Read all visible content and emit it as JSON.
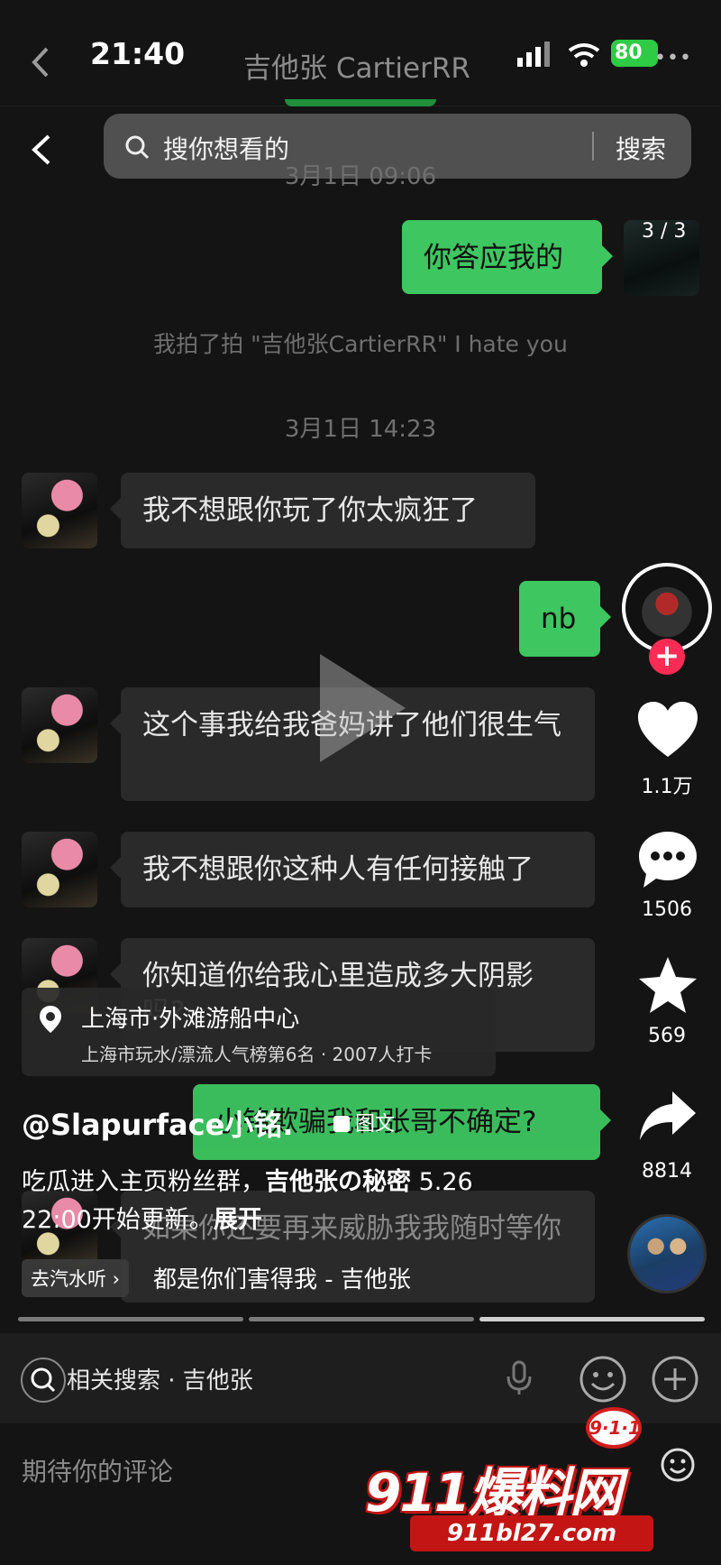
{
  "status_bar": {
    "time": "21:40",
    "battery": "80"
  },
  "chat": {
    "title": "吉他张 CartierRR",
    "messages_1": {
      "timestamp": "3月1日 09:06",
      "out_text": "你答应我的"
    },
    "system_msg": "我拍了拍 \"吉他张CartierRR\" I hate you",
    "messages_2": {
      "timestamp": "3月1日 14:23",
      "m1": "我不想跟你玩了你太疯狂了",
      "m2": "nb",
      "m3": "这个事我给我爸妈讲了他们很生气",
      "m4": "我不想跟你这种人有任何接触了",
      "m5": "你知道你给我心里造成多大阴影吗?",
      "m6": "小铭欺骗我和张哥不确定?",
      "m7": "如果你还要再来威胁我我随时等你"
    }
  },
  "search": {
    "placeholder": "搜你想看的",
    "button": "搜索"
  },
  "video": {
    "page_counter": "3 / 3",
    "likes": "1.1万",
    "comments": "1506",
    "favorites": "569",
    "shares": "8814",
    "follow": "+",
    "location": {
      "title": "上海市·外滩游船中心",
      "subtitle": "上海市玩水/漂流人气榜第6名 · 2007人打卡"
    },
    "author": "@Slapurface小铭.",
    "tag": "图文",
    "caption_prefix": "吃瓜进入主页粉丝群，",
    "caption_bold": "吉他张の秘密",
    "caption_suffix": " 5.26 22:00开始更新。",
    "caption_expand": "展开",
    "music_tag": "去汽水听 ›",
    "music_title": "都是你们害得我 - 吉他张"
  },
  "related": {
    "label": "相关搜索 · 吉他张"
  },
  "comment": {
    "placeholder": "期待你的评论"
  },
  "watermark": {
    "badge": "9·1·1",
    "brand": "911爆料网",
    "url": "911bl27.com"
  },
  "colors": {
    "bubble_out": "#3ec660",
    "bubble_in": "#2a2a2a",
    "follow": "#fe2c55",
    "brand_red": "#c41515"
  },
  "icons": [
    "back-icon",
    "search-icon",
    "play-icon",
    "heart-icon",
    "comment-icon",
    "star-icon",
    "share-icon",
    "pin-icon",
    "mic-icon",
    "emoji-icon",
    "plus-icon"
  ]
}
